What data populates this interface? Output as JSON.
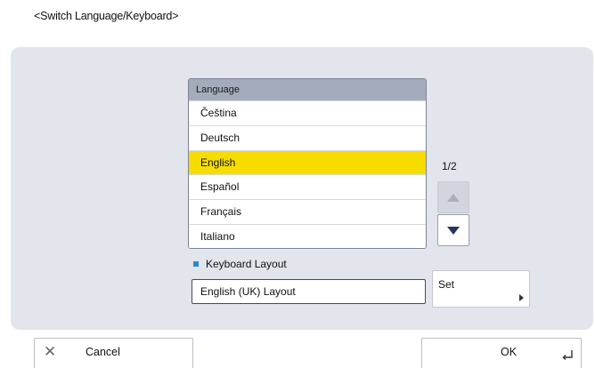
{
  "page_title": "<Switch Language/Keyboard>",
  "language_list": {
    "header": "Language",
    "items": [
      "Čeština",
      "Deutsch",
      "English",
      "Español",
      "Français",
      "Italiano"
    ],
    "selected": "English"
  },
  "pagination": {
    "indicator": "1/2",
    "up_icon": "triangle-up-icon",
    "down_icon": "triangle-down-icon"
  },
  "keyboard": {
    "label": "Keyboard Layout",
    "value": "English (UK) Layout",
    "set_label": "Set"
  },
  "footer": {
    "cancel_label": "Cancel",
    "ok_label": "OK"
  },
  "colors": {
    "selected_row": "#f7dc00",
    "panel_bg": "#e3e5ec",
    "list_header": "#a4acbb",
    "accent_square": "#2a8ad2",
    "scroll_down_arrow": "#27355a"
  }
}
